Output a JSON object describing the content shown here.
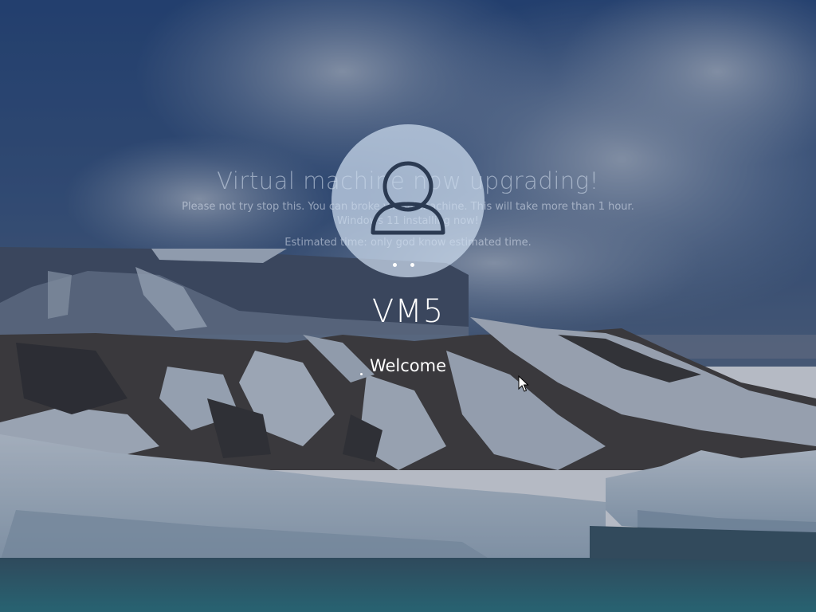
{
  "upgrade_message": {
    "title": "Virtual machine now upgrading!",
    "line1": "Please not try stop this. You can broke virtual machine. This will take more than 1 hour.",
    "line2": "Windows 11 installing now!",
    "line3": "Estimated time: only god know estimated time."
  },
  "login": {
    "username": "VM5",
    "status": "Welcome"
  },
  "icons": {
    "avatar": "user-avatar-icon",
    "spinner": "loading-spinner-icon",
    "cursor": "mouse-pointer-icon"
  },
  "colors": {
    "sky": "#2a4a7a",
    "overlay": "#1f2f4a",
    "avatar_bg": "#cfdcee"
  }
}
